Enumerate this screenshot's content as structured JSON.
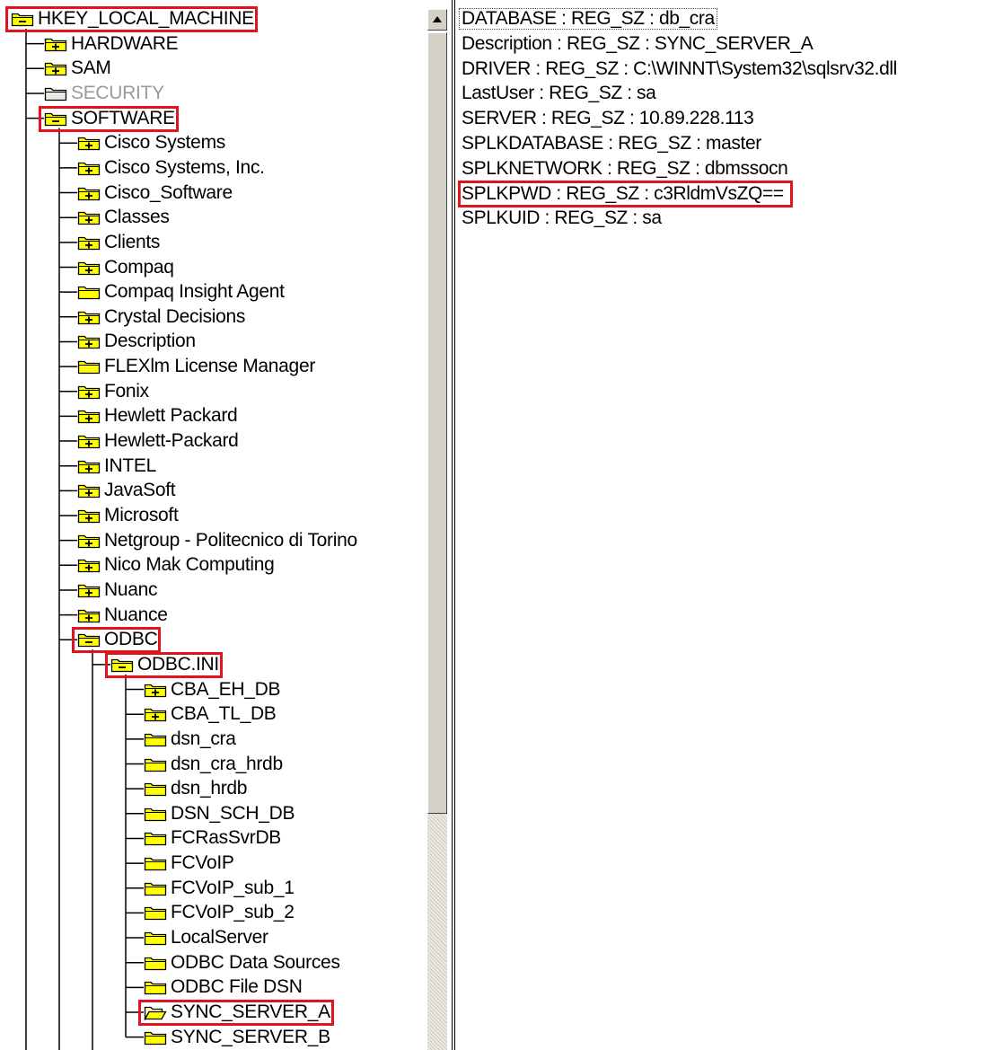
{
  "tree": {
    "nodes": [
      {
        "label": "HKEY_LOCAL_MACHINE",
        "depth": 0,
        "icon": "folder-open-icon",
        "state": "expanded"
      },
      {
        "label": "HARDWARE",
        "depth": 1,
        "icon": "folder-plus-icon",
        "state": "collapsed"
      },
      {
        "label": "SAM",
        "depth": 1,
        "icon": "folder-plus-icon",
        "state": "collapsed"
      },
      {
        "label": "SECURITY",
        "depth": 1,
        "icon": "folder-icon",
        "state": "disabled"
      },
      {
        "label": "SOFTWARE",
        "depth": 1,
        "icon": "folder-minus-icon",
        "state": "expanded"
      },
      {
        "label": "Cisco Systems",
        "depth": 2,
        "icon": "folder-plus-icon",
        "state": "collapsed"
      },
      {
        "label": "Cisco Systems, Inc.",
        "depth": 2,
        "icon": "folder-plus-icon",
        "state": "collapsed"
      },
      {
        "label": "Cisco_Software",
        "depth": 2,
        "icon": "folder-plus-icon",
        "state": "collapsed"
      },
      {
        "label": "Classes",
        "depth": 2,
        "icon": "folder-plus-icon",
        "state": "collapsed"
      },
      {
        "label": "Clients",
        "depth": 2,
        "icon": "folder-plus-icon",
        "state": "collapsed"
      },
      {
        "label": "Compaq",
        "depth": 2,
        "icon": "folder-plus-icon",
        "state": "collapsed"
      },
      {
        "label": "Compaq Insight Agent",
        "depth": 2,
        "icon": "folder-icon",
        "state": "leaf"
      },
      {
        "label": "Crystal Decisions",
        "depth": 2,
        "icon": "folder-plus-icon",
        "state": "collapsed"
      },
      {
        "label": "Description",
        "depth": 2,
        "icon": "folder-plus-icon",
        "state": "collapsed"
      },
      {
        "label": "FLEXlm License Manager",
        "depth": 2,
        "icon": "folder-icon",
        "state": "leaf"
      },
      {
        "label": "Fonix",
        "depth": 2,
        "icon": "folder-plus-icon",
        "state": "collapsed"
      },
      {
        "label": "Hewlett Packard",
        "depth": 2,
        "icon": "folder-plus-icon",
        "state": "collapsed"
      },
      {
        "label": "Hewlett-Packard",
        "depth": 2,
        "icon": "folder-plus-icon",
        "state": "collapsed"
      },
      {
        "label": "INTEL",
        "depth": 2,
        "icon": "folder-plus-icon",
        "state": "collapsed"
      },
      {
        "label": "JavaSoft",
        "depth": 2,
        "icon": "folder-plus-icon",
        "state": "collapsed"
      },
      {
        "label": "Microsoft",
        "depth": 2,
        "icon": "folder-plus-icon",
        "state": "collapsed"
      },
      {
        "label": "Netgroup - Politecnico di Torino",
        "depth": 2,
        "icon": "folder-plus-icon",
        "state": "collapsed"
      },
      {
        "label": "Nico Mak Computing",
        "depth": 2,
        "icon": "folder-plus-icon",
        "state": "collapsed"
      },
      {
        "label": "Nuanc",
        "depth": 2,
        "icon": "folder-plus-icon",
        "state": "collapsed"
      },
      {
        "label": "Nuance",
        "depth": 2,
        "icon": "folder-plus-icon",
        "state": "collapsed"
      },
      {
        "label": "ODBC",
        "depth": 2,
        "icon": "folder-minus-icon",
        "state": "expanded"
      },
      {
        "label": "ODBC.INI",
        "depth": 3,
        "icon": "folder-minus-icon",
        "state": "expanded"
      },
      {
        "label": "CBA_EH_DB",
        "depth": 4,
        "icon": "folder-plus-icon",
        "state": "collapsed"
      },
      {
        "label": "CBA_TL_DB",
        "depth": 4,
        "icon": "folder-plus-icon",
        "state": "collapsed"
      },
      {
        "label": "dsn_cra",
        "depth": 4,
        "icon": "folder-icon",
        "state": "leaf"
      },
      {
        "label": "dsn_cra_hrdb",
        "depth": 4,
        "icon": "folder-icon",
        "state": "leaf"
      },
      {
        "label": "dsn_hrdb",
        "depth": 4,
        "icon": "folder-icon",
        "state": "leaf"
      },
      {
        "label": "DSN_SCH_DB",
        "depth": 4,
        "icon": "folder-icon",
        "state": "leaf"
      },
      {
        "label": "FCRasSvrDB",
        "depth": 4,
        "icon": "folder-icon",
        "state": "leaf"
      },
      {
        "label": "FCVoIP",
        "depth": 4,
        "icon": "folder-icon",
        "state": "leaf"
      },
      {
        "label": "FCVoIP_sub_1",
        "depth": 4,
        "icon": "folder-icon",
        "state": "leaf"
      },
      {
        "label": "FCVoIP_sub_2",
        "depth": 4,
        "icon": "folder-icon",
        "state": "leaf"
      },
      {
        "label": "LocalServer",
        "depth": 4,
        "icon": "folder-icon",
        "state": "leaf"
      },
      {
        "label": "ODBC Data Sources",
        "depth": 4,
        "icon": "folder-icon",
        "state": "leaf"
      },
      {
        "label": "ODBC File DSN",
        "depth": 4,
        "icon": "folder-icon",
        "state": "leaf"
      },
      {
        "label": "SYNC_SERVER_A",
        "depth": 4,
        "icon": "folder-open-icon",
        "state": "selected"
      },
      {
        "label": "SYNC_SERVER_B",
        "depth": 4,
        "icon": "folder-icon",
        "state": "leaf"
      }
    ]
  },
  "values": {
    "rows": [
      "DATABASE : REG_SZ : db_cra",
      "Description : REG_SZ : SYNC_SERVER_A",
      "DRIVER : REG_SZ : C:\\WINNT\\System32\\sqlsrv32.dll",
      "LastUser : REG_SZ : sa",
      "SERVER : REG_SZ : 10.89.228.113",
      "SPLKDATABASE : REG_SZ : master",
      "SPLKNETWORK : REG_SZ : dbmssocn",
      "SPLKPWD : REG_SZ : c3RldmVsZQ==",
      "SPLKUID : REG_SZ : sa"
    ],
    "focused_row": "DATABASE : REG_SZ : db_cra",
    "highlighted_row": "SPLKPWD : REG_SZ : c3RldmVsZQ=="
  },
  "highlighted_nodes": [
    "HKEY_LOCAL_MACHINE",
    "SOFTWARE",
    "ODBC",
    "ODBC.INI",
    "SYNC_SERVER_A"
  ],
  "colors": {
    "highlight": "#e0141e",
    "folder": "#ffff00",
    "disabled_text": "#9a9a9a"
  },
  "scrollbar": {
    "up_arrow_icon": "scroll-up-arrow-icon"
  }
}
